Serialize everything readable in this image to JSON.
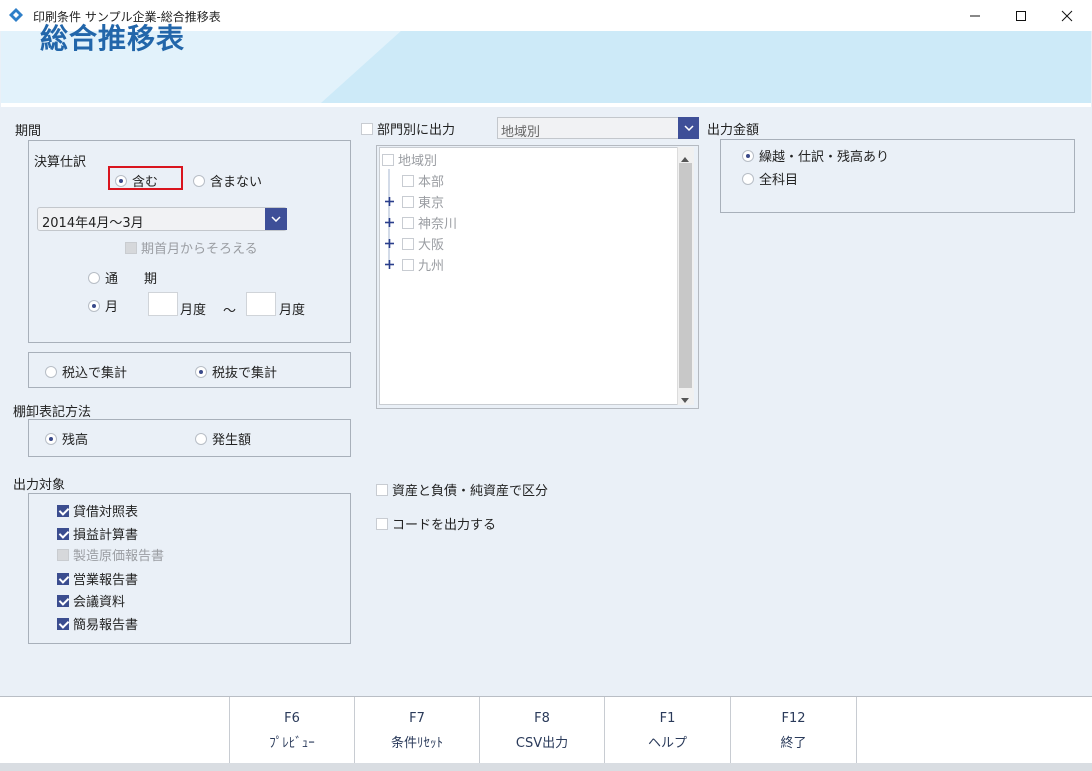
{
  "window": {
    "title": "印刷条件 サンプル企業-総合推移表",
    "min_label": "—",
    "max_label": "☐",
    "close_label": "✕"
  },
  "header": {
    "title": "総合推移表"
  },
  "period": {
    "heading": "期間",
    "closing_heading": "決算仕訳",
    "include_label": "含む",
    "exclude_label": "含まない",
    "include_selected": true,
    "range_value": "2014年4月～3月",
    "align_label": "期首月からそろえる",
    "full_label": "通　　期",
    "month_label": "月",
    "month_selected": true,
    "from_value": "",
    "from_suffix": "月度",
    "tilde": "～",
    "to_value": "",
    "to_suffix": "月度"
  },
  "tax": {
    "inclusive_label": "税込で集計",
    "exclusive_label": "税抜で集計",
    "exclusive_selected": true
  },
  "inventory": {
    "heading": "棚卸表記方法",
    "balance_label": "残高",
    "occurrence_label": "発生額",
    "balance_selected": true
  },
  "targets": {
    "heading": "出力対象",
    "items": [
      {
        "label": "貸借対照表",
        "checked": true,
        "disabled": false
      },
      {
        "label": "損益計算書",
        "checked": true,
        "disabled": false
      },
      {
        "label": "製造原価報告書",
        "checked": false,
        "disabled": true
      },
      {
        "label": "営業報告書",
        "checked": true,
        "disabled": false
      },
      {
        "label": "会議資料",
        "checked": true,
        "disabled": false
      },
      {
        "label": "簡易報告書",
        "checked": true,
        "disabled": false
      }
    ]
  },
  "department": {
    "checkbox_label": "部門別に出力",
    "combo_value": "地域別",
    "tree_root": "地域別",
    "tree_items": [
      {
        "label": "本部",
        "expandable": false
      },
      {
        "label": "東京",
        "expandable": true
      },
      {
        "label": "神奈川",
        "expandable": true
      },
      {
        "label": "大阪",
        "expandable": true
      },
      {
        "label": "九州",
        "expandable": true
      }
    ]
  },
  "options": {
    "split_assets_label": "資産と負債・純資産で区分",
    "output_code_label": "コードを出力する"
  },
  "amount": {
    "heading": "出力金額",
    "with_carry_label": "繰越・仕訳・残高あり",
    "all_accounts_label": "全科目",
    "with_carry_selected": true
  },
  "fkeys": [
    {
      "key": "F6",
      "name": "ﾌﾟﾚﾋﾞｭｰ"
    },
    {
      "key": "F7",
      "name": "条件ﾘｾｯﾄ"
    },
    {
      "key": "F8",
      "name": "CSV出力"
    },
    {
      "key": "F1",
      "name": "ヘルプ"
    },
    {
      "key": "F12",
      "name": "終了"
    }
  ],
  "colors": {
    "accent": "#3e4f98",
    "title_blue": "#2266aa",
    "highlight_red": "#d9141e",
    "background": "#eaf0f7"
  }
}
